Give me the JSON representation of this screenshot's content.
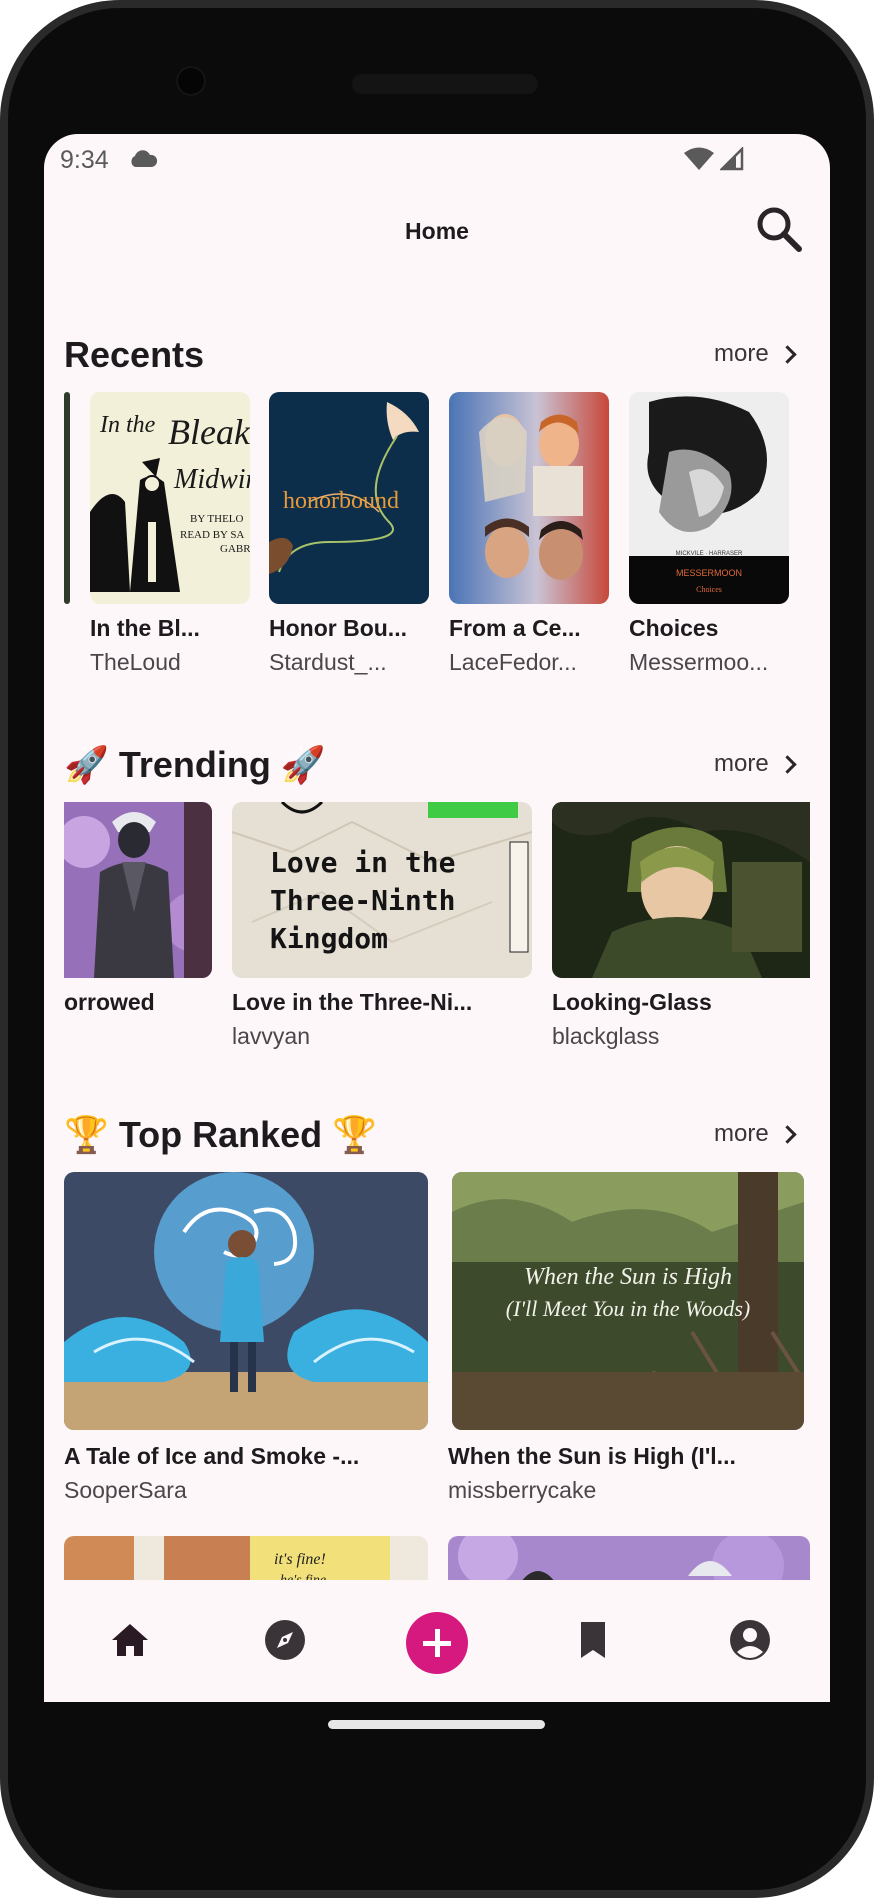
{
  "status_bar": {
    "time": "9:34"
  },
  "header": {
    "title": "Home"
  },
  "recents": {
    "title": "Recents",
    "more_label": "more",
    "items": [
      {
        "title": "In the Bl...",
        "author": "TheLoud",
        "cover_text": "In the Bleak Midwinter"
      },
      {
        "title": "Honor Bou...",
        "author": "Stardust_...",
        "cover_text": "honorbound"
      },
      {
        "title": "From a Ce...",
        "author": "LaceFedor...",
        "cover_text": ""
      },
      {
        "title": "Choices",
        "author": "Messermoo...",
        "cover_text": "MESSERMOON"
      }
    ]
  },
  "trending": {
    "title": "🚀 Trending 🚀",
    "more_label": "more",
    "items": [
      {
        "title": "orrowed",
        "author": ""
      },
      {
        "title": "Love in the Three-Ni...",
        "author": "lavvyan",
        "cover_text": "Love in the Three-Ninth Kingdom"
      },
      {
        "title": "Looking-Glass",
        "author": "blackglass"
      }
    ]
  },
  "top_ranked": {
    "title": "🏆 Top Ranked 🏆",
    "more_label": "more",
    "items": [
      {
        "title": "A Tale of Ice and Smoke -...",
        "author": "SooperSara"
      },
      {
        "title": "When the Sun is High (I'l...",
        "author": "missberrycake",
        "cover_text": "When the Sun is High (I'll Meet You in the Woods)"
      }
    ]
  },
  "bottom_nav": [
    "home-icon",
    "explore-icon",
    "add-icon",
    "bookmark-icon",
    "account-icon"
  ],
  "colors": {
    "accent": "#d6197f",
    "background": "#fdf7fa",
    "text": "#1e1b1e"
  }
}
